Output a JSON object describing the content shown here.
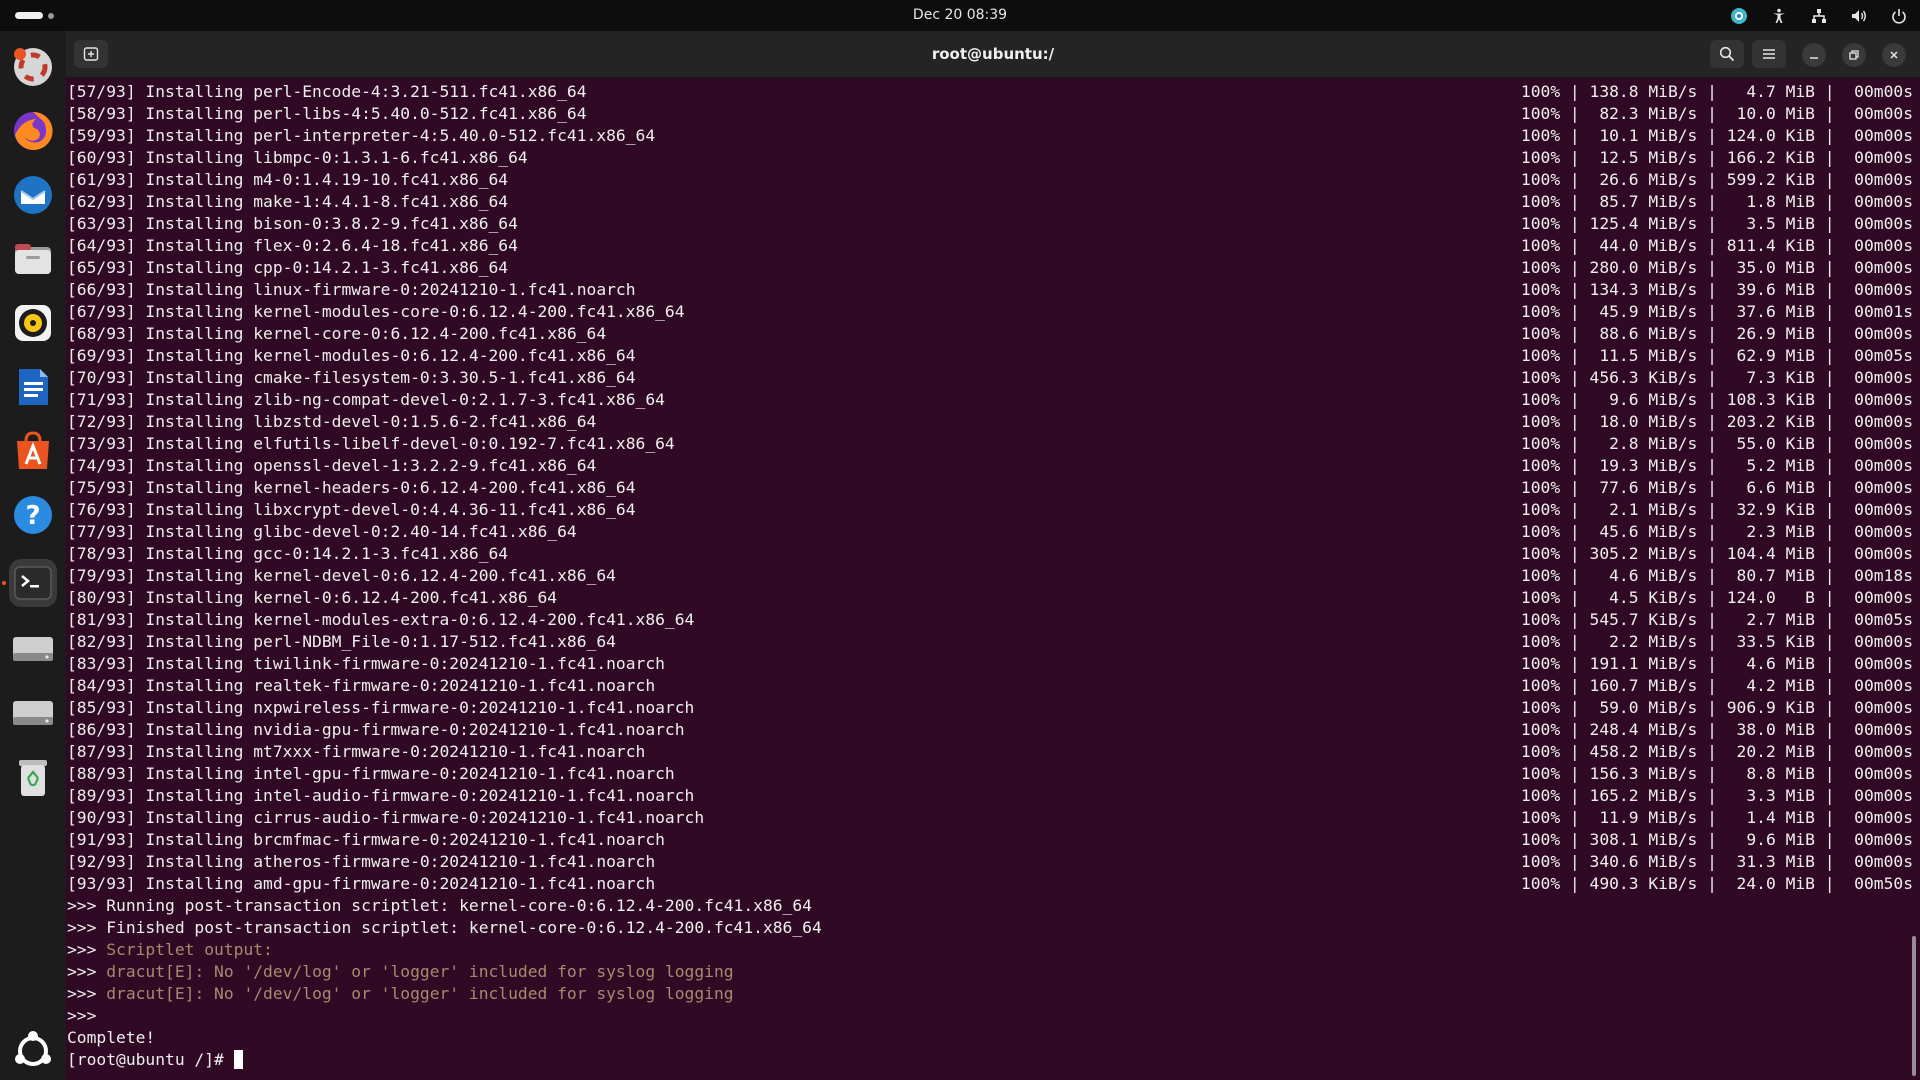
{
  "topbar": {
    "clock": "Dec 20  08:39",
    "tray_icons": [
      "copilot-icon",
      "accessibility-icon",
      "network-icon",
      "volume-icon",
      "power-icon"
    ]
  },
  "dock": {
    "apps": [
      {
        "name": "help-app-icon",
        "color": "#e95420"
      },
      {
        "name": "firefox-icon",
        "color": "#ff7139"
      },
      {
        "name": "thunderbird-icon",
        "color": "#1f73c4"
      },
      {
        "name": "files-icon",
        "color": "#c24a54"
      },
      {
        "name": "rhythmbox-icon",
        "color": "#f5c518"
      },
      {
        "name": "libreoffice-writer-icon",
        "color": "#1f66c2"
      },
      {
        "name": "app-center-icon",
        "color": "#e95420"
      },
      {
        "name": "help-icon",
        "color": "#2a8be0"
      },
      {
        "name": "terminal-icon",
        "color": "#2b2b2b"
      },
      {
        "name": "drive-icon",
        "color": "#bcbcbc"
      },
      {
        "name": "drive-icon",
        "color": "#bcbcbc"
      },
      {
        "name": "trash-icon",
        "color": "#dcdcdc"
      },
      {
        "name": "show-apps-icon",
        "color": "#ffffff"
      }
    ]
  },
  "window": {
    "title": "root@ubuntu:/"
  },
  "terminal": {
    "lines": [
      {
        "left": "[57/93] Installing perl-Encode-4:3.21-511.fc41.x86_64",
        "right": "100% | 138.8 MiB/s |   4.7 MiB |  00m00s"
      },
      {
        "left": "[58/93] Installing perl-libs-4:5.40.0-512.fc41.x86_64",
        "right": "100% |  82.3 MiB/s |  10.0 MiB |  00m00s"
      },
      {
        "left": "[59/93] Installing perl-interpreter-4:5.40.0-512.fc41.x86_64",
        "right": "100% |  10.1 MiB/s | 124.0 KiB |  00m00s"
      },
      {
        "left": "[60/93] Installing libmpc-0:1.3.1-6.fc41.x86_64",
        "right": "100% |  12.5 MiB/s | 166.2 KiB |  00m00s"
      },
      {
        "left": "[61/93] Installing m4-0:1.4.19-10.fc41.x86_64",
        "right": "100% |  26.6 MiB/s | 599.2 KiB |  00m00s"
      },
      {
        "left": "[62/93] Installing make-1:4.4.1-8.fc41.x86_64",
        "right": "100% |  85.7 MiB/s |   1.8 MiB |  00m00s"
      },
      {
        "left": "[63/93] Installing bison-0:3.8.2-9.fc41.x86_64",
        "right": "100% | 125.4 MiB/s |   3.5 MiB |  00m00s"
      },
      {
        "left": "[64/93] Installing flex-0:2.6.4-18.fc41.x86_64",
        "right": "100% |  44.0 MiB/s | 811.4 KiB |  00m00s"
      },
      {
        "left": "[65/93] Installing cpp-0:14.2.1-3.fc41.x86_64",
        "right": "100% | 280.0 MiB/s |  35.0 MiB |  00m00s"
      },
      {
        "left": "[66/93] Installing linux-firmware-0:20241210-1.fc41.noarch",
        "right": "100% | 134.3 MiB/s |  39.6 MiB |  00m00s"
      },
      {
        "left": "[67/93] Installing kernel-modules-core-0:6.12.4-200.fc41.x86_64",
        "right": "100% |  45.9 MiB/s |  37.6 MiB |  00m01s"
      },
      {
        "left": "[68/93] Installing kernel-core-0:6.12.4-200.fc41.x86_64",
        "right": "100% |  88.6 MiB/s |  26.9 MiB |  00m00s"
      },
      {
        "left": "[69/93] Installing kernel-modules-0:6.12.4-200.fc41.x86_64",
        "right": "100% |  11.5 MiB/s |  62.9 MiB |  00m05s"
      },
      {
        "left": "[70/93] Installing cmake-filesystem-0:3.30.5-1.fc41.x86_64",
        "right": "100% | 456.3 KiB/s |   7.3 KiB |  00m00s"
      },
      {
        "left": "[71/93] Installing zlib-ng-compat-devel-0:2.1.7-3.fc41.x86_64",
        "right": "100% |   9.6 MiB/s | 108.3 KiB |  00m00s"
      },
      {
        "left": "[72/93] Installing libzstd-devel-0:1.5.6-2.fc41.x86_64",
        "right": "100% |  18.0 MiB/s | 203.2 KiB |  00m00s"
      },
      {
        "left": "[73/93] Installing elfutils-libelf-devel-0:0.192-7.fc41.x86_64",
        "right": "100% |   2.8 MiB/s |  55.0 KiB |  00m00s"
      },
      {
        "left": "[74/93] Installing openssl-devel-1:3.2.2-9.fc41.x86_64",
        "right": "100% |  19.3 MiB/s |   5.2 MiB |  00m00s"
      },
      {
        "left": "[75/93] Installing kernel-headers-0:6.12.4-200.fc41.x86_64",
        "right": "100% |  77.6 MiB/s |   6.6 MiB |  00m00s"
      },
      {
        "left": "[76/93] Installing libxcrypt-devel-0:4.4.36-11.fc41.x86_64",
        "right": "100% |   2.1 MiB/s |  32.9 KiB |  00m00s"
      },
      {
        "left": "[77/93] Installing glibc-devel-0:2.40-14.fc41.x86_64",
        "right": "100% |  45.6 MiB/s |   2.3 MiB |  00m00s"
      },
      {
        "left": "[78/93] Installing gcc-0:14.2.1-3.fc41.x86_64",
        "right": "100% | 305.2 MiB/s | 104.4 MiB |  00m00s"
      },
      {
        "left": "[79/93] Installing kernel-devel-0:6.12.4-200.fc41.x86_64",
        "right": "100% |   4.6 MiB/s |  80.7 MiB |  00m18s"
      },
      {
        "left": "[80/93] Installing kernel-0:6.12.4-200.fc41.x86_64",
        "right": "100% |   4.5 KiB/s | 124.0   B |  00m00s"
      },
      {
        "left": "[81/93] Installing kernel-modules-extra-0:6.12.4-200.fc41.x86_64",
        "right": "100% | 545.7 KiB/s |   2.7 MiB |  00m05s"
      },
      {
        "left": "[82/93] Installing perl-NDBM_File-0:1.17-512.fc41.x86_64",
        "right": "100% |   2.2 MiB/s |  33.5 KiB |  00m00s"
      },
      {
        "left": "[83/93] Installing tiwilink-firmware-0:20241210-1.fc41.noarch",
        "right": "100% | 191.1 MiB/s |   4.6 MiB |  00m00s"
      },
      {
        "left": "[84/93] Installing realtek-firmware-0:20241210-1.fc41.noarch",
        "right": "100% | 160.7 MiB/s |   4.2 MiB |  00m00s"
      },
      {
        "left": "[85/93] Installing nxpwireless-firmware-0:20241210-1.fc41.noarch",
        "right": "100% |  59.0 MiB/s | 906.9 KiB |  00m00s"
      },
      {
        "left": "[86/93] Installing nvidia-gpu-firmware-0:20241210-1.fc41.noarch",
        "right": "100% | 248.4 MiB/s |  38.0 MiB |  00m00s"
      },
      {
        "left": "[87/93] Installing mt7xxx-firmware-0:20241210-1.fc41.noarch",
        "right": "100% | 458.2 MiB/s |  20.2 MiB |  00m00s"
      },
      {
        "left": "[88/93] Installing intel-gpu-firmware-0:20241210-1.fc41.noarch",
        "right": "100% | 156.3 MiB/s |   8.8 MiB |  00m00s"
      },
      {
        "left": "[89/93] Installing intel-audio-firmware-0:20241210-1.fc41.noarch",
        "right": "100% | 165.2 MiB/s |   3.3 MiB |  00m00s"
      },
      {
        "left": "[90/93] Installing cirrus-audio-firmware-0:20241210-1.fc41.noarch",
        "right": "100% |  11.9 MiB/s |   1.4 MiB |  00m00s"
      },
      {
        "left": "[91/93] Installing brcmfmac-firmware-0:20241210-1.fc41.noarch",
        "right": "100% | 308.1 MiB/s |   9.6 MiB |  00m00s"
      },
      {
        "left": "[92/93] Installing atheros-firmware-0:20241210-1.fc41.noarch",
        "right": "100% | 340.6 MiB/s |  31.3 MiB |  00m00s"
      },
      {
        "left": "[93/93] Installing amd-gpu-firmware-0:20241210-1.fc41.noarch",
        "right": "100% | 490.3 KiB/s |  24.0 MiB |  00m50s"
      },
      {
        "left": ">>> Running post-transaction scriptlet: kernel-core-0:6.12.4-200.fc41.x86_64"
      },
      {
        "left": ">>> Finished post-transaction scriptlet: kernel-core-0:6.12.4-200.fc41.x86_64"
      },
      {
        "left": ">>> ",
        "dim": "Scriptlet output:"
      },
      {
        "left": ">>> ",
        "dim": "dracut[E]: No '/dev/log' or 'logger' included for syslog logging"
      },
      {
        "left": ">>> ",
        "dim": "dracut[E]: No '/dev/log' or 'logger' included for syslog logging"
      },
      {
        "left": ">>>"
      },
      {
        "left": "Complete!"
      }
    ],
    "prompt": "[root@ubuntu /]# ",
    "colors": {
      "background": "#300a24",
      "foreground": "#eeeeec",
      "dim_output": "#a58a6f"
    }
  }
}
